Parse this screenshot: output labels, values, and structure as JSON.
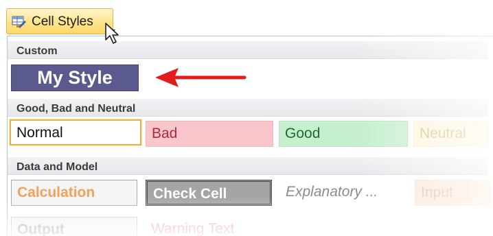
{
  "ribbon": {
    "cell_styles_label": "Cell Styles",
    "icon": "cell-styles-icon",
    "arrow_icon": "dropdown-arrow-icon"
  },
  "gallery": {
    "custom": {
      "header": "Custom",
      "items": [
        "My Style"
      ],
      "my_style_colors": {
        "background": "#5b5a8e",
        "text": "#ffffff"
      }
    },
    "good_bad_neutral": {
      "header": "Good, Bad and Neutral",
      "items": [
        "Normal",
        "Bad",
        "Good",
        "Neutral"
      ]
    },
    "data_and_model": {
      "header": "Data and Model",
      "items": [
        "Calculation",
        "Check Cell",
        "Explanatory ...",
        "Input",
        "Output",
        "Warning Text"
      ]
    }
  },
  "annotation": {
    "arrow_color": "#e21b1b",
    "arrow_icon": "red-arrow-icon"
  },
  "cursor": {
    "icon": "mouse-pointer-icon"
  }
}
